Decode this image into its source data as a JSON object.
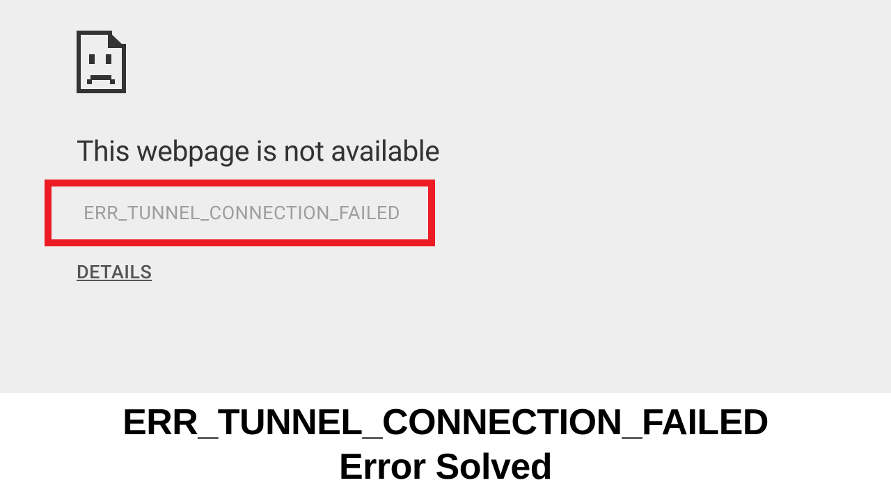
{
  "errorPage": {
    "heading": "This webpage is not available",
    "errorCode": "ERR_TUNNEL_CONNECTION_FAILED",
    "detailsLabel": "DETAILS"
  },
  "caption": {
    "line1": "ERR_TUNNEL_CONNECTION_FAILED",
    "line2": "Error Solved"
  }
}
